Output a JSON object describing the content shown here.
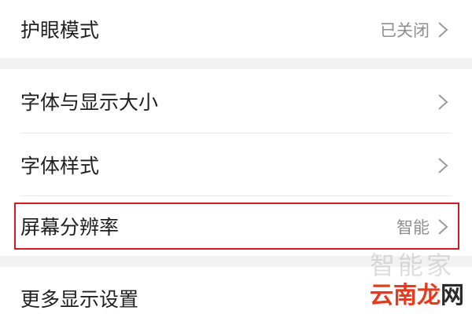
{
  "settings": {
    "eye_mode": {
      "label": "护眼模式",
      "value": "已关闭"
    },
    "font_display_size": {
      "label": "字体与显示大小"
    },
    "font_style": {
      "label": "字体样式"
    },
    "screen_resolution": {
      "label": "屏幕分辨率",
      "value": "智能"
    },
    "more_display": {
      "label": "更多显示设置"
    }
  },
  "watermark": {
    "faint": "智能家",
    "brand_colored": "云南龙",
    "brand_dark": "网"
  },
  "colors": {
    "highlight_border": "#d01c22",
    "section_gap": "#f2f2f2",
    "value_text": "#8e8e8e"
  },
  "icons": {
    "row_arrow": "chevron-right-icon"
  }
}
